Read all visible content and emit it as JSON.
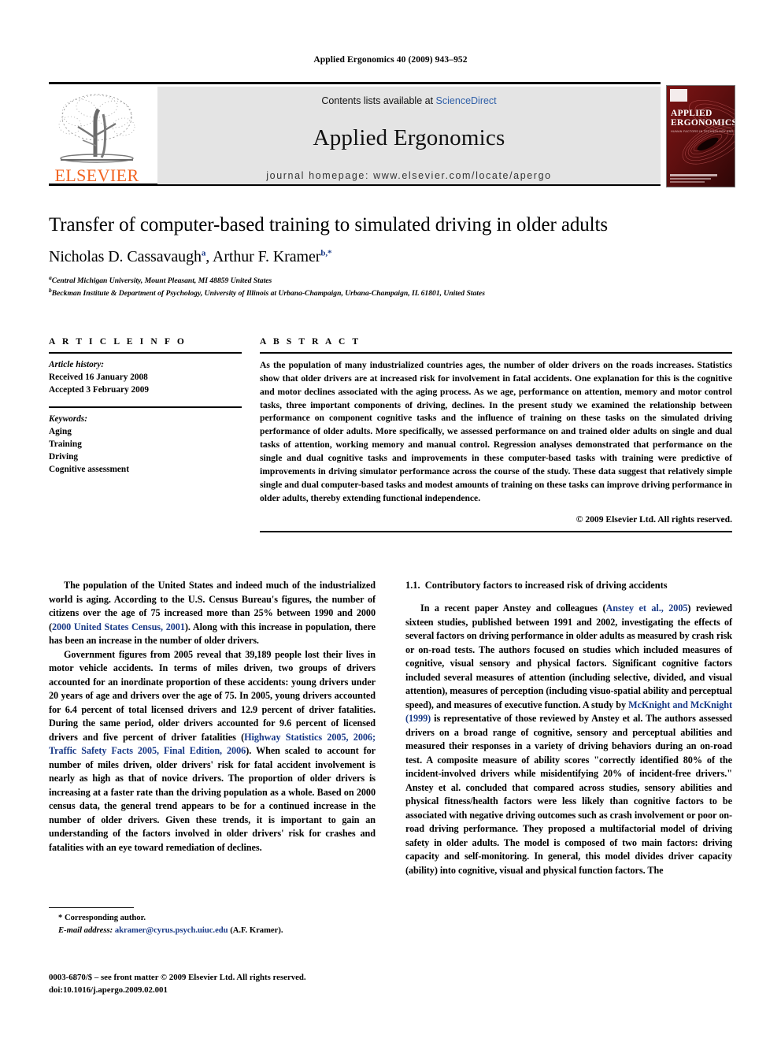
{
  "running_head": "Applied Ergonomics 40 (2009) 943–952",
  "masthead": {
    "publisher_logo_text": "ELSEVIER",
    "contents_prefix": "Contents lists available at",
    "sciencedirect": "ScienceDirect",
    "journal_name": "Applied Ergonomics",
    "homepage": "journal homepage: www.elsevier.com/locate/apergo",
    "cover": {
      "line1": "APPLIED",
      "line2": "ERGONOMICS",
      "tagline": "HUMAN FACTORS IN TECHNOLOGY AND SOCIETY"
    },
    "link_color": "#2f5fa8",
    "elsevier_orange": "#F26522"
  },
  "title": "Transfer of computer-based training to simulated driving in older adults",
  "authors": {
    "name1": "Nicholas D. Cassavaugh",
    "sup1": "a",
    "separator": ", ",
    "name2": "Arthur F. Kramer",
    "sup2": "b,*"
  },
  "affiliations": [
    {
      "marker": "a",
      "text": "Central Michigan University, Mount Pleasant, MI 48859 United States"
    },
    {
      "marker": "b",
      "text": "Beckman Institute & Department of Psychology, University of Illinois at Urbana-Champaign, Urbana-Champaign, IL 61801, United States"
    }
  ],
  "article_info": {
    "heading": "A R T I C L E  I N F O",
    "history_label": "Article history:",
    "received": "Received 16 January 2008",
    "accepted": "Accepted 3 February 2009",
    "keywords_label": "Keywords:",
    "keywords": [
      "Aging",
      "Training",
      "Driving",
      "Cognitive assessment"
    ]
  },
  "abstract": {
    "heading": "A B S T R A C T",
    "text": "As the population of many industrialized countries ages, the number of older drivers on the roads increases. Statistics show that older drivers are at increased risk for involvement in fatal accidents. One explanation for this is the cognitive and motor declines associated with the aging process. As we age, performance on attention, memory and motor control tasks, three important components of driving, declines. In the present study we examined the relationship between performance on component cognitive tasks and the influence of training on these tasks on the simulated driving performance of older adults. More specifically, we assessed performance on and trained older adults on single and dual tasks of attention, working memory and manual control. Regression analyses demonstrated that performance on the single and dual cognitive tasks and improvements in these computer-based tasks with training were predictive of improvements in driving simulator performance across the course of the study. These data suggest that relatively simple single and dual computer-based tasks and modest amounts of training on these tasks can improve driving performance in older adults, thereby extending functional independence.",
    "copyright": "© 2009 Elsevier Ltd. All rights reserved."
  },
  "body": {
    "left_col": {
      "p1_a": "The population of the United States and indeed much of the industrialized world is aging. According to the U.S. Census Bureau's figures, the number of citizens over the age of 75 increased more than 25% between 1990 and 2000 (",
      "p1_ref": "2000 United States Census, 2001",
      "p1_b": "). Along with this increase in population, there has been an increase in the number of older drivers.",
      "p2_a": "Government figures from 2005 reveal that 39,189 people lost their lives in motor vehicle accidents. In terms of miles driven, two groups of drivers accounted for an inordinate proportion of these accidents: young drivers under 20 years of age and drivers over the age of 75. In 2005, young drivers accounted for 6.4 percent of total licensed drivers and 12.9 percent of driver fatalities. During the same period, older drivers accounted for 9.6 percent of licensed drivers and five percent of driver fatalities (",
      "p2_ref1": "Highway Statistics 2005, 2006",
      "p2_mid": "; ",
      "p2_ref2": "Traffic Safety Facts 2005, Final Edition, 2006",
      "p2_b": "). When scaled to account for number of miles driven, older drivers' risk for fatal accident involvement is nearly as high as that of novice drivers. The proportion of older drivers is increasing at a faster rate than the driving population as a whole. Based on 2000 census data, the general trend appears to be for a continued increase in the number of older drivers. Given these trends, it is important to gain an understanding of the factors involved in older drivers' risk for crashes and fatalities with an eye toward remediation of declines."
    },
    "right_col": {
      "section_number": "1.1.",
      "section_title": "Contributory factors to increased risk of driving accidents",
      "p1_a": "In a recent paper Anstey and colleagues (",
      "p1_ref1": "Anstey et al., 2005",
      "p1_b": ") reviewed sixteen studies, published between 1991 and 2002, investigating the effects of several factors on driving performance in older adults as measured by crash risk or on-road tests. The authors focused on studies which included measures of cognitive, visual sensory and physical factors. Significant cognitive factors included several measures of attention (including selective, divided, and visual attention), measures of perception (including visuo-spatial ability and perceptual speed), and measures of executive function. A study by ",
      "p1_ref2": "McKnight and McKnight (1999)",
      "p1_c": " is representative of those reviewed by Anstey et al. The authors assessed drivers on a broad range of cognitive, sensory and perceptual abilities and measured their responses in a variety of driving behaviors during an on-road test. A composite measure of ability scores \"correctly identified 80% of the incident-involved drivers while misidentifying 20% of incident-free drivers.\" Anstey et al. concluded that compared across studies, sensory abilities and physical fitness/health factors were less likely than cognitive factors to be associated with negative driving outcomes such as crash involvement or poor on-road driving performance. They proposed a multifactorial model of driving safety in older adults. The model is composed of two main factors: driving capacity and self-monitoring. In general, this model divides driver capacity (ability) into cognitive, visual and physical function factors. The"
    }
  },
  "footnote": {
    "corresponding": "* Corresponding author.",
    "email_label": "E-mail address:",
    "email": "akramer@cyrus.psych.uiuc.edu",
    "email_suffix": "(A.F. Kramer)."
  },
  "imprint": {
    "line1": "0003-6870/$ – see front matter © 2009 Elsevier Ltd. All rights reserved.",
    "line2": "doi:10.1016/j.apergo.2009.02.001"
  }
}
